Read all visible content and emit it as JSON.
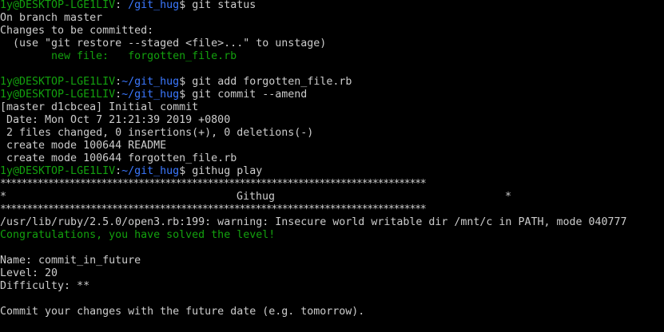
{
  "prompt": {
    "user_host": "1y@DESKTOP-LGE1LIV",
    "colon": ":",
    "path": "~/git_hug",
    "sigil": "$",
    "path_first": "/git_hug"
  },
  "lines": {
    "cmd_status": "git status",
    "branch": "On branch master",
    "to_commit": "Changes to be committed:",
    "unstage_hint": "(use \"git restore --staged <file>...\" to unstage)",
    "new_file_label": "new file:",
    "new_file_name": "forgotten_file.rb",
    "blank": "",
    "cmd_add": "git add forgotten_file.rb",
    "cmd_amend": "git commit --amend",
    "commit_hdr": "[master d1cbcea] Initial commit",
    "date": " Date: Mon Oct 7 21:21:39 2019 +0800",
    "changes": " 2 files changed, 0 insertions(+), 0 deletions(-)",
    "create_readme": " create mode 100644 README",
    "create_rb": " create mode 100644 forgotten_file.rb",
    "cmd_play": "githug play",
    "stars": "********************************************************************************",
    "banner_left": "*",
    "banner_title": "Githug",
    "banner_right": "*",
    "warning": "/usr/lib/ruby/2.5.0/open3.rb:199: warning: Insecure world writable dir /mnt/c in PATH, mode 040777",
    "congrats": "Congratulations, you have solved the level!",
    "name": "Name: commit_in_future",
    "level": "Level: 20",
    "difficulty": "Difficulty: **",
    "description": "Commit your changes with the future date (e.g. tomorrow)."
  },
  "colors": {
    "background": "#000000",
    "foreground": "#cccccc",
    "green": "#13a10e",
    "blue": "#3b78ff"
  }
}
